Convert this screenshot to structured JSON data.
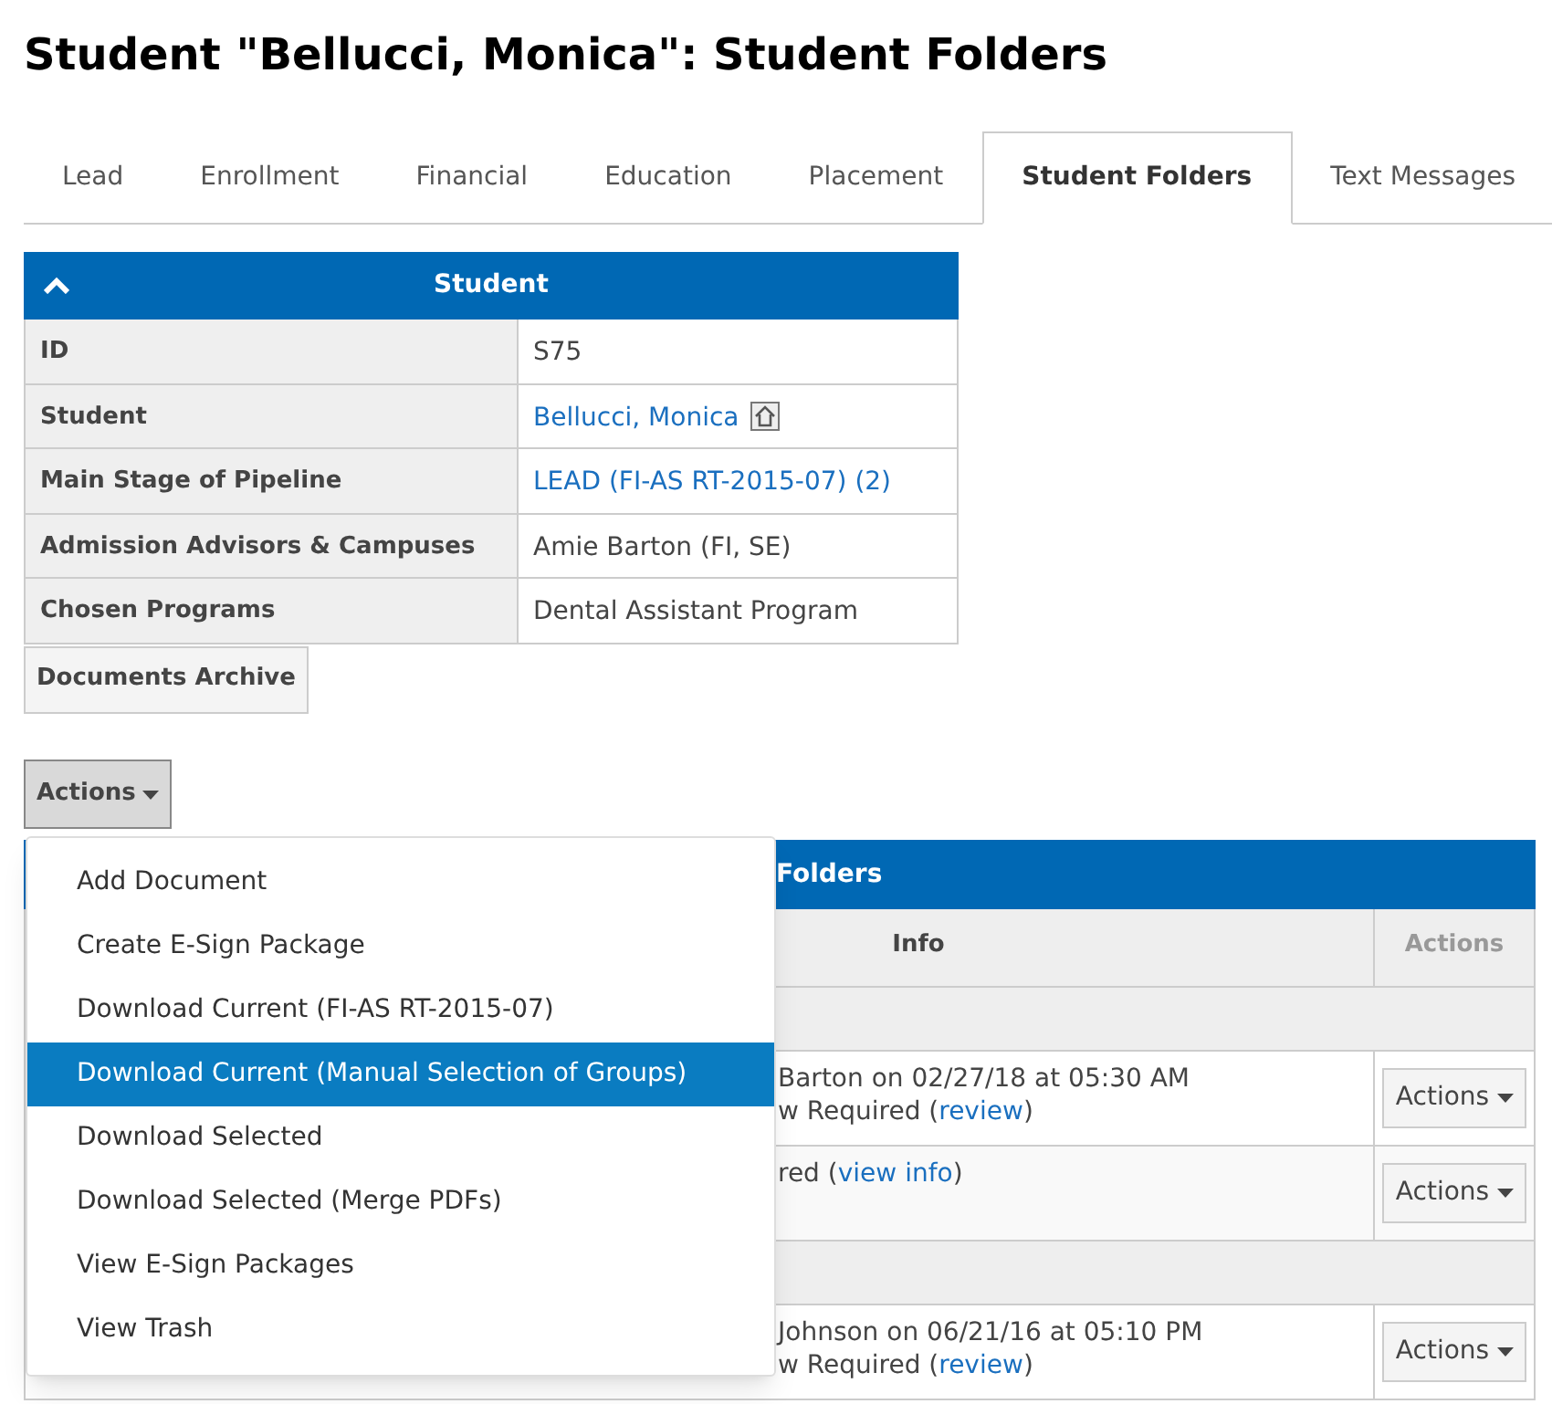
{
  "page_title": "Student \"Bellucci, Monica\": Student Folders",
  "tabs": [
    {
      "label": "Lead",
      "selected": false
    },
    {
      "label": "Enrollment",
      "selected": false
    },
    {
      "label": "Financial",
      "selected": false
    },
    {
      "label": "Education",
      "selected": false
    },
    {
      "label": "Placement",
      "selected": false
    },
    {
      "label": "Student Folders",
      "selected": true
    },
    {
      "label": "Text Messages",
      "selected": false
    }
  ],
  "student_panel": {
    "title": "Student",
    "expanded": true,
    "rows": [
      {
        "label": "ID",
        "value": "S75",
        "kind": "text"
      },
      {
        "label": "Student",
        "value": "Bellucci, Monica",
        "kind": "link_home"
      },
      {
        "label": "Main Stage of Pipeline",
        "value": "LEAD (FI-AS RT-2015-07) (2)",
        "kind": "link"
      },
      {
        "label": "Admission Advisors & Campuses",
        "value": "Amie Barton (FI, SE)",
        "kind": "text"
      },
      {
        "label": "Chosen Programs",
        "value": "Dental Assistant Program",
        "kind": "text"
      }
    ]
  },
  "documents_archive_button": "Documents Archive",
  "actions_button": "Actions",
  "actions_menu": [
    {
      "label": "Add Document",
      "selected": false
    },
    {
      "label": "Create E-Sign Package",
      "selected": false
    },
    {
      "label": "Download Current (FI-AS RT-2015-07)",
      "selected": false
    },
    {
      "label": "Download Current (Manual Selection of Groups)",
      "selected": true
    },
    {
      "label": "Download Selected",
      "selected": false
    },
    {
      "label": "Download Selected (Merge PDFs)",
      "selected": false
    },
    {
      "label": "View E-Sign Packages",
      "selected": false
    },
    {
      "label": "View Trash",
      "selected": false
    }
  ],
  "folders_table": {
    "title": "Folders",
    "columns": [
      "Info",
      "Actions"
    ],
    "rows": [
      {
        "kind": "group"
      },
      {
        "kind": "document",
        "lines": [
          {
            "text": "Barton on 02/27/18 at 05:30 AM"
          },
          {
            "text": "w Required (",
            "link": "review",
            "after": ")"
          }
        ],
        "action": "Actions"
      },
      {
        "kind": "document",
        "lines": [
          {
            "text": "red (",
            "link": "view info",
            "after": ")"
          }
        ],
        "action": "Actions"
      },
      {
        "kind": "group"
      },
      {
        "kind": "document",
        "lines": [
          {
            "text": "Johnson on 06/21/16 at 05:10 PM"
          },
          {
            "text": "w Required (",
            "link": "review",
            "after": ")"
          }
        ],
        "action": "Actions"
      }
    ]
  }
}
